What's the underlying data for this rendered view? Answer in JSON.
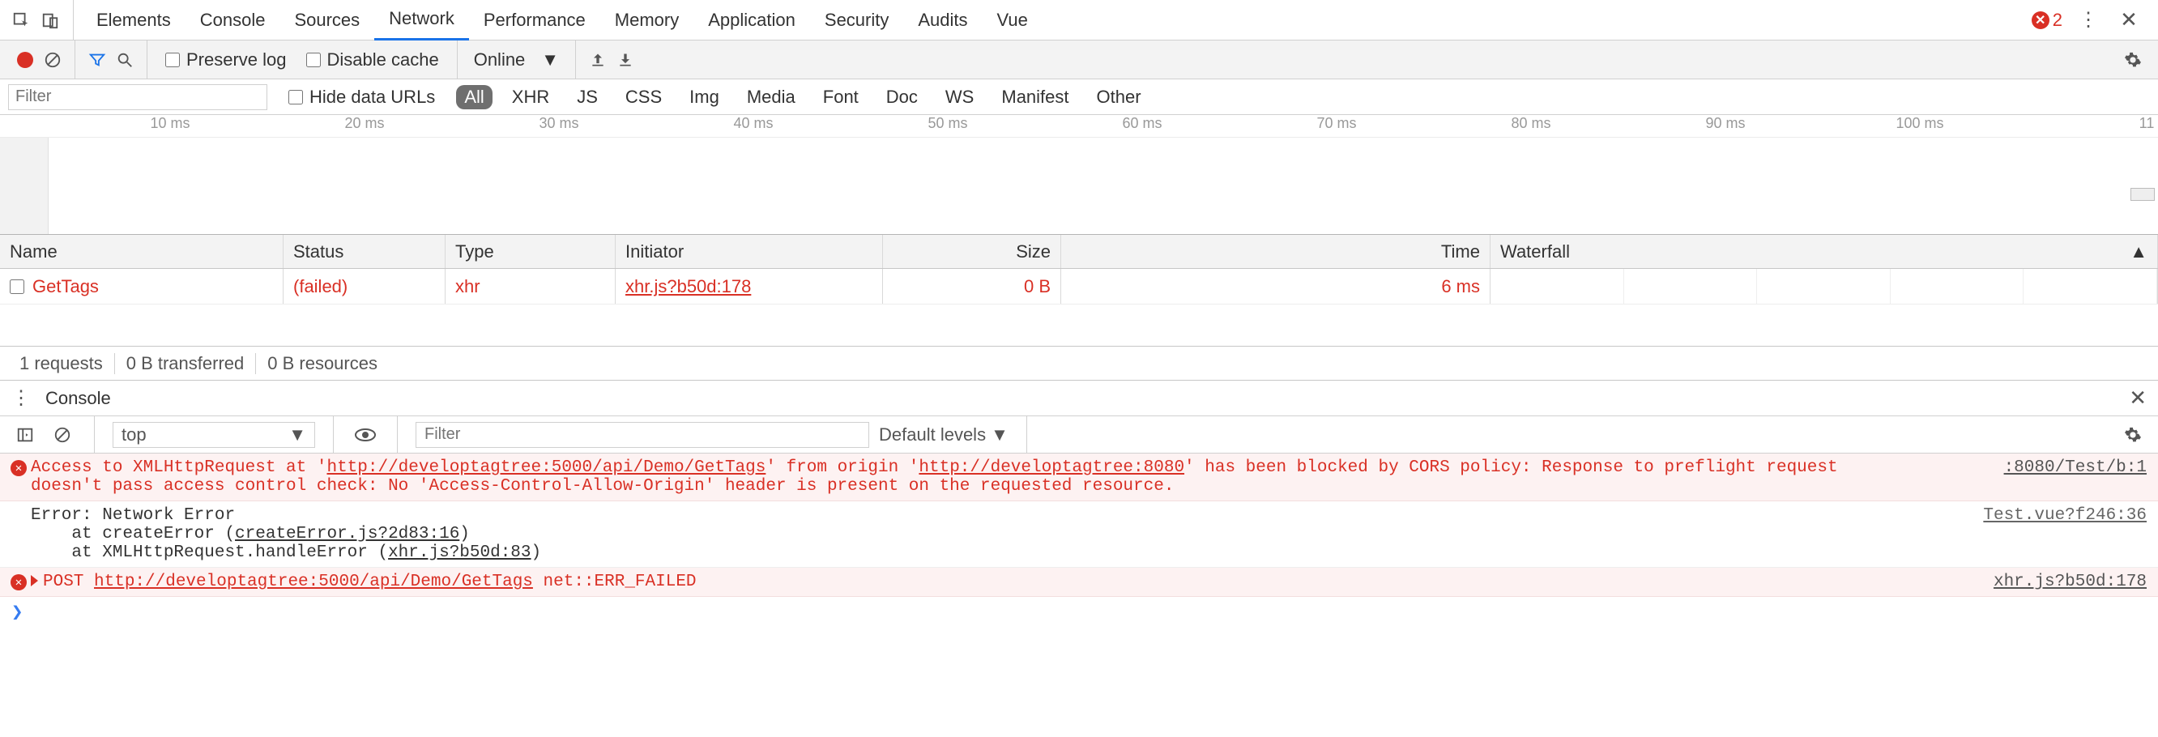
{
  "topbar": {
    "tabs": [
      "Elements",
      "Console",
      "Sources",
      "Network",
      "Performance",
      "Memory",
      "Application",
      "Security",
      "Audits",
      "Vue"
    ],
    "active": "Network",
    "error_count": "2"
  },
  "toolbar": {
    "preserve_log": "Preserve log",
    "disable_cache": "Disable cache",
    "throttling": "Online"
  },
  "filterbar": {
    "filter_placeholder": "Filter",
    "hide_data_urls": "Hide data URLs",
    "types": [
      "All",
      "XHR",
      "JS",
      "CSS",
      "Img",
      "Media",
      "Font",
      "Doc",
      "WS",
      "Manifest",
      "Other"
    ],
    "active_type": "All"
  },
  "timeline": {
    "ticks": [
      "10 ms",
      "20 ms",
      "30 ms",
      "40 ms",
      "50 ms",
      "60 ms",
      "70 ms",
      "80 ms",
      "90 ms",
      "100 ms",
      "11"
    ]
  },
  "table": {
    "headers": {
      "name": "Name",
      "status": "Status",
      "type": "Type",
      "initiator": "Initiator",
      "size": "Size",
      "time": "Time",
      "waterfall": "Waterfall"
    },
    "rows": [
      {
        "name": "GetTags",
        "status": "(failed)",
        "type": "xhr",
        "initiator": "xhr.js?b50d:178",
        "size": "0 B",
        "time": "6 ms"
      }
    ]
  },
  "summary": {
    "requests": "1 requests",
    "transferred": "0 B transferred",
    "resources": "0 B resources"
  },
  "drawer": {
    "title": "Console"
  },
  "console_tb": {
    "context": "top",
    "filter_placeholder": "Filter",
    "levels": "Default levels"
  },
  "messages": {
    "cors": {
      "pre": "Access to XMLHttpRequest at '",
      "url1": "http://developtagtree:5000/api/Demo/GetTags",
      "mid": "' from origin '",
      "url2": "http://developtagtree:8080",
      "post1": "' has been blocked by CORS policy: Response to preflight request",
      "post2": "doesn't pass access control check: No 'Access-Control-Allow-Origin' header is present on the requested resource.",
      "src": ":8080/Test/b:1"
    },
    "stack": {
      "l1": "Error: Network Error",
      "l2": "    at createError (",
      "l2link": "createError.js?2d83:16",
      "l2end": ")",
      "l3": "    at XMLHttpRequest.handleError (",
      "l3link": "xhr.js?b50d:83",
      "l3end": ")",
      "src": "Test.vue?f246:36"
    },
    "post": {
      "method": "POST ",
      "url": "http://developtagtree:5000/api/Demo/GetTags",
      "tail": " net::ERR_FAILED",
      "src": "xhr.js?b50d:178"
    }
  }
}
